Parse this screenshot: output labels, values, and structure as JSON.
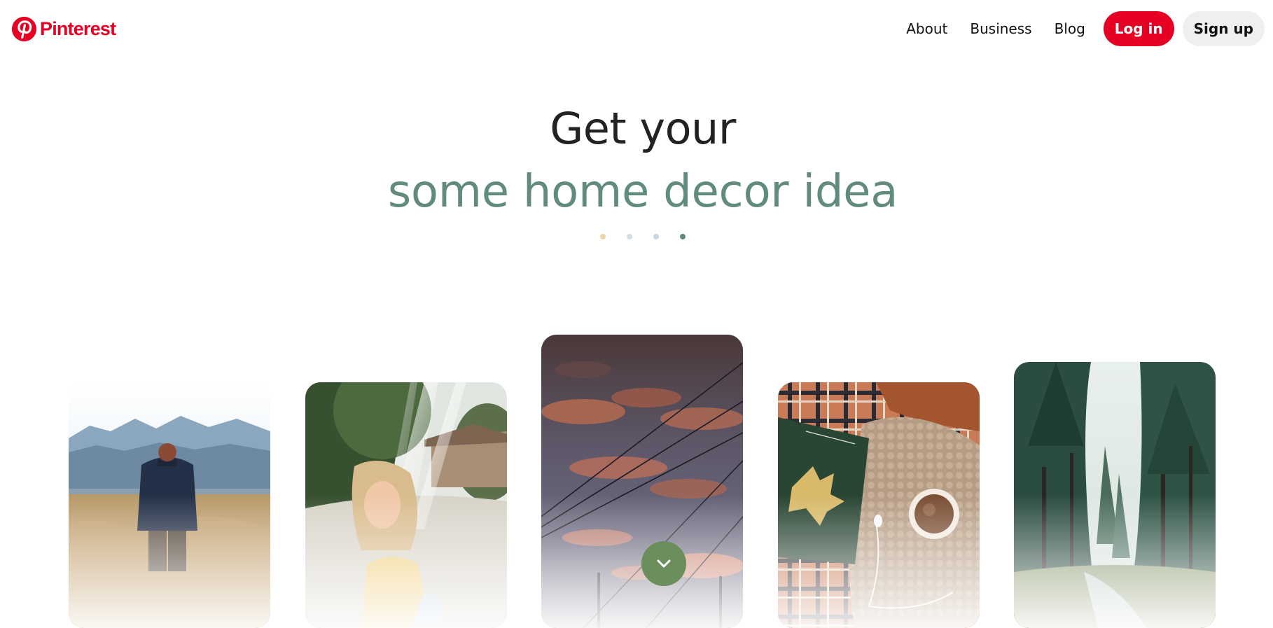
{
  "header": {
    "logo_text": "Pinterest",
    "nav": {
      "about": "About",
      "business": "Business",
      "blog": "Blog"
    },
    "login_label": "Log in",
    "signup_label": "Sign up"
  },
  "hero": {
    "line1": "Get your",
    "line2": "some home decor idea",
    "dot_colors": [
      "#e8d7a8",
      "#d6dde4",
      "#c7d6e4",
      "#5f8a7a"
    ]
  },
  "colors": {
    "brand": "#e60023",
    "accent": "#618c7b",
    "scroll_button": "#6c8d5c"
  },
  "cards": [
    {
      "subject": "person in hiking jacket walking through golden field toward mountains"
    },
    {
      "subject": "smiling blonde woman in yellow top on sunlit dirt path"
    },
    {
      "subject": "sunset sky with pink clouds and power lines"
    },
    {
      "subject": "autumn leaf, notebook, cup of cocoa and knit sweater on plaid blanket"
    },
    {
      "subject": "tall pine forest with a small creek"
    }
  ],
  "scroll_button_icon": "chevron-down-icon"
}
